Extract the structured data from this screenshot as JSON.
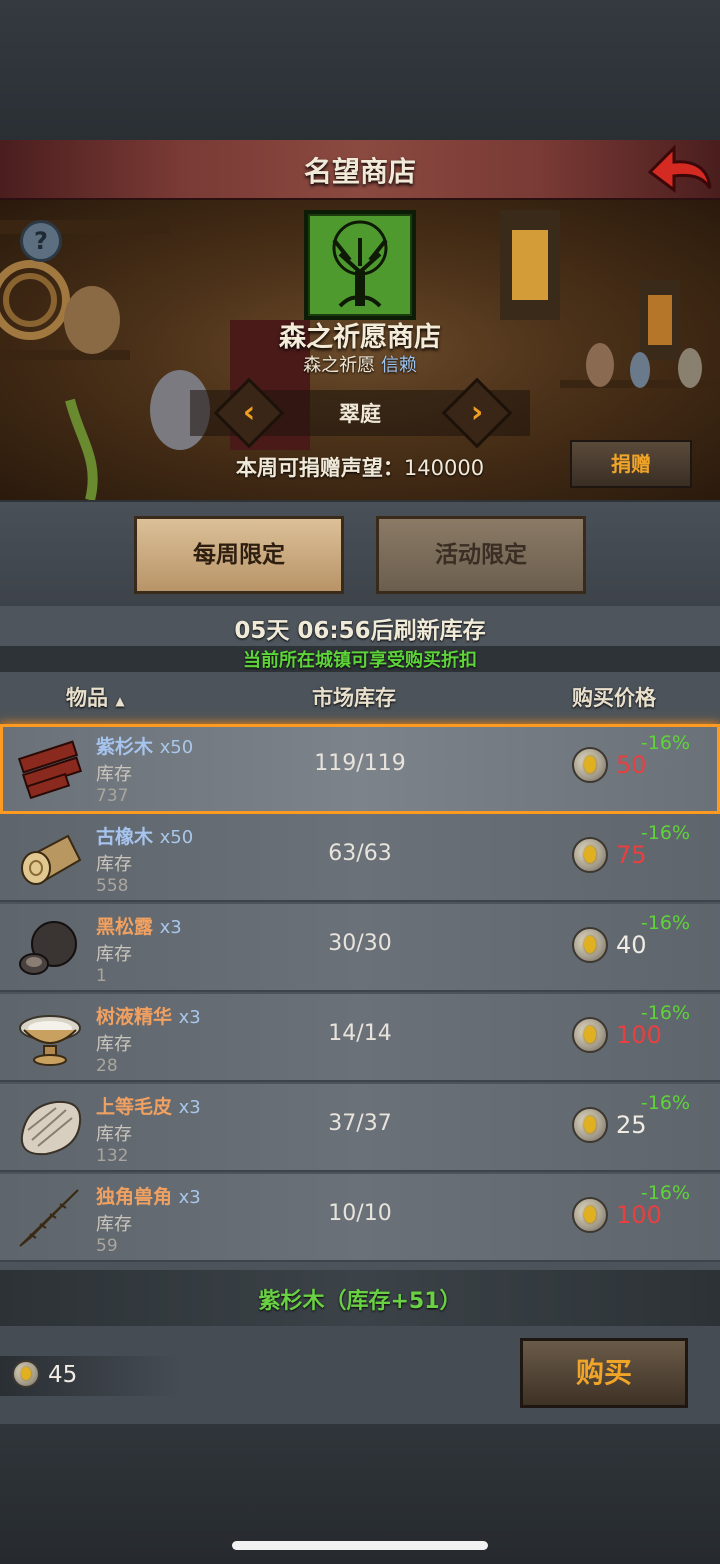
{
  "header": {
    "title": "名望商店"
  },
  "shop": {
    "name": "森之祈愿商店",
    "faction": "森之祈愿",
    "trust": "信赖",
    "region": "翠庭",
    "reputation_label": "本周可捐赠声望：",
    "reputation_value": "140000",
    "donate_label": "捐赠"
  },
  "tabs": [
    {
      "label": "每周限定",
      "active": true
    },
    {
      "label": "活动限定",
      "active": false
    }
  ],
  "refresh": {
    "text": "05天 06:56后刷新库存"
  },
  "discount_note": "当前所在城镇可享受购买折扣",
  "columns": {
    "item": "物品",
    "sort_arrow": "▲",
    "stock": "市场库存",
    "price": "购买价格"
  },
  "inventory_label": "库存",
  "items": [
    {
      "name": "紫杉木",
      "qty": "x50",
      "inventory": "737",
      "stock": "119/119",
      "price": "50",
      "discount": "-16%",
      "selected": true
    },
    {
      "name": "古橡木",
      "qty": "x50",
      "inventory": "558",
      "stock": "63/63",
      "price": "75",
      "discount": "-16%",
      "selected": false
    },
    {
      "name": "黑松露",
      "qty": "x3",
      "inventory": "1",
      "stock": "30/30",
      "price": "40",
      "discount": "-16%",
      "selected": false
    },
    {
      "name": "树液精华",
      "qty": "x3",
      "inventory": "28",
      "stock": "14/14",
      "price": "100",
      "discount": "-16%",
      "selected": false
    },
    {
      "name": "上等毛皮",
      "qty": "x3",
      "inventory": "132",
      "stock": "37/37",
      "price": "25",
      "discount": "-16%",
      "selected": false
    },
    {
      "name": "独角兽角",
      "qty": "x3",
      "inventory": "59",
      "stock": "10/10",
      "price": "100",
      "discount": "-16%",
      "selected": false
    }
  ],
  "selection": {
    "text": "紫杉木（库存+51）"
  },
  "wallet": {
    "amount": "45"
  },
  "buy_label": "购买",
  "colors": {
    "accent": "#f0a428",
    "discount": "#5ed43a",
    "price_red": "#e84040",
    "selected_border": "#ff9a20"
  }
}
